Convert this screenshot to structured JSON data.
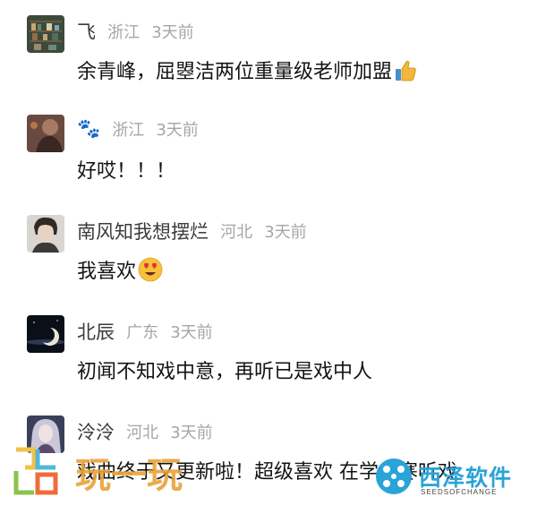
{
  "comments": [
    {
      "name": "飞",
      "location": "浙江",
      "time": "3天前",
      "text": "余青峰，屈曌洁两位重量级老师加盟",
      "emoji": "thumbs-up-icon"
    },
    {
      "name": "🐾",
      "location": "浙江",
      "time": "3天前",
      "text": "好哎！！！",
      "emoji": ""
    },
    {
      "name": "南风知我想摆烂",
      "location": "河北",
      "time": "3天前",
      "text": "我喜欢",
      "emoji": "heart-eyes-icon"
    },
    {
      "name": "北辰",
      "location": "广东",
      "time": "3天前",
      "text": "初闻不知戏中意，再听已是戏中人",
      "emoji": ""
    },
    {
      "name": "泠泠",
      "location": "河北",
      "time": "3天前",
      "text": "戏曲终于又更新啦！超级喜欢 在学小寒听戏",
      "emoji": ""
    }
  ],
  "watermarks": {
    "left_text": "玩一玩",
    "right_cn": "西泽软件",
    "right_en": "SEEDSOFCHANGE"
  }
}
